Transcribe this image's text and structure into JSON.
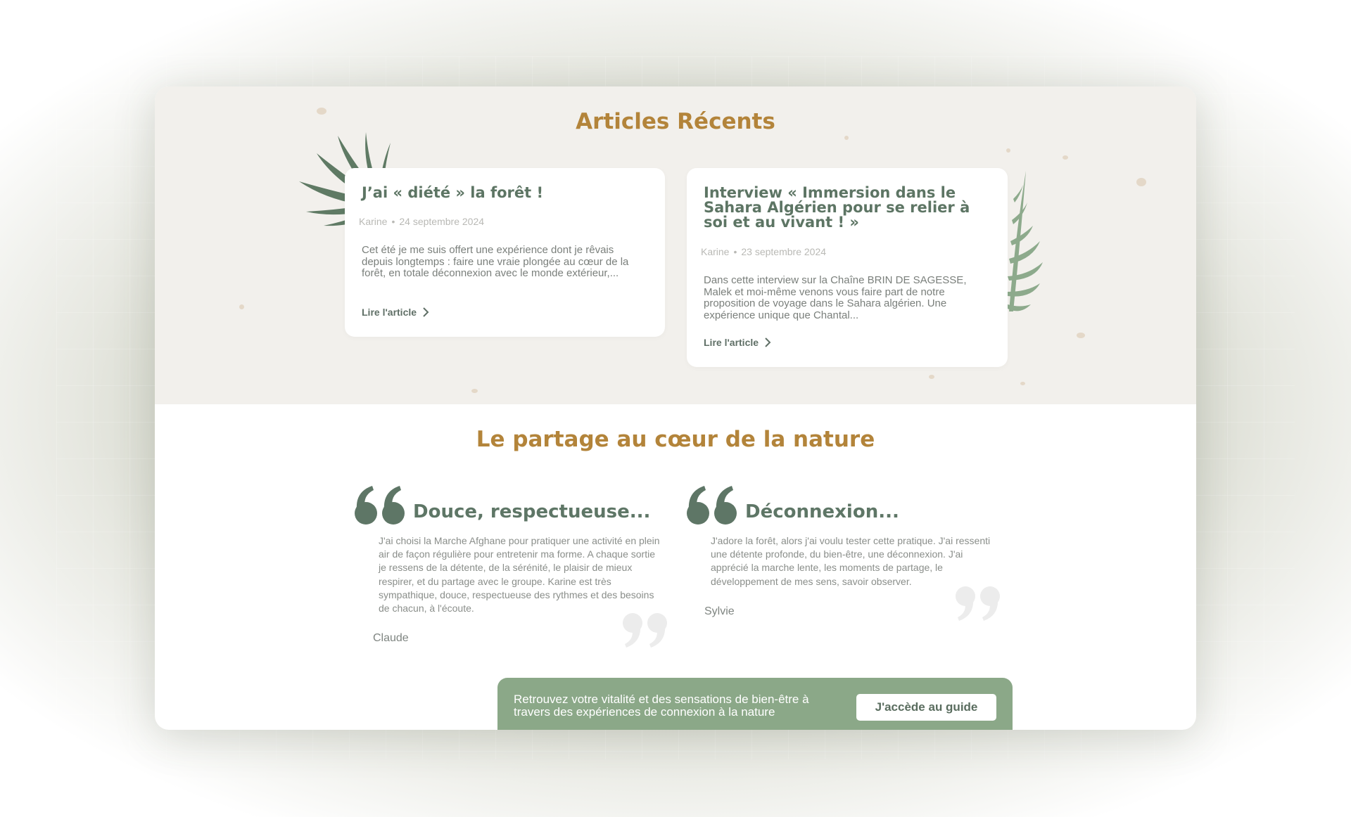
{
  "recent_articles": {
    "title": "Articles Récents",
    "articles": [
      {
        "title": "J’ai « diété » la forêt !",
        "author": "Karine",
        "separator": "•",
        "date": "24 septembre 2024",
        "excerpt": "Cet été je me suis offert une expérience dont je rêvais depuis longtemps : faire une vraie plongée au cœur de la forêt, en totale déconnexion avec le monde extérieur,...",
        "link_label": "Lire l'article"
      },
      {
        "title": "Interview « Immersion dans le Sahara Algérien pour se relier à soi et au vivant ! »",
        "author": "Karine",
        "separator": "•",
        "date": "23 septembre 2024",
        "excerpt": "Dans cette interview sur la Chaîne BRIN DE SAGESSE, Malek et moi-même venons vous faire part de notre proposition de voyage dans le Sahara algérien. Une expérience unique que Chantal...",
        "link_label": "Lire l'article"
      }
    ]
  },
  "testimonials": {
    "title": "Le partage au cœur de la nature",
    "items": [
      {
        "title": "Douce, respectueuse...",
        "text": "J'ai choisi la Marche Afghane pour pratiquer une activité en plein air de façon régulière pour entretenir ma forme. A chaque sortie je ressens de la détente, de la sérénité, le plaisir de mieux respirer, et du partage avec le groupe. Karine est très sympathique, douce, respectueuse des rythmes et des besoins de chacun, à l'écoute.",
        "name": "Claude"
      },
      {
        "title": "Déconnexion...",
        "text": "J'adore la forêt, alors j'ai voulu tester cette pratique. J'ai ressenti une détente profonde, du bien-être, une déconnexion. J'ai apprécié la marche lente, les moments de partage, le développement de mes sens, savoir observer.",
        "name": "Sylvie"
      }
    ]
  },
  "cta": {
    "text": "Retrouvez votre vitalité et des sensations de bien-être à travers des expériences de connexion à la nature",
    "button_label": "J'accède au guide"
  },
  "icons": {
    "open_quote": "open-quote-icon",
    "close_quote": "close-quote-icon",
    "chevron": "chevron-right-icon",
    "leaf_left": "palm-leaf-icon",
    "leaf_right": "fern-leaf-icon"
  },
  "colors": {
    "accent_gold": "#b3843a",
    "green_dark": "#5e7666",
    "green_cta": "#8ba888",
    "beige_bg": "#f2f0ec"
  }
}
